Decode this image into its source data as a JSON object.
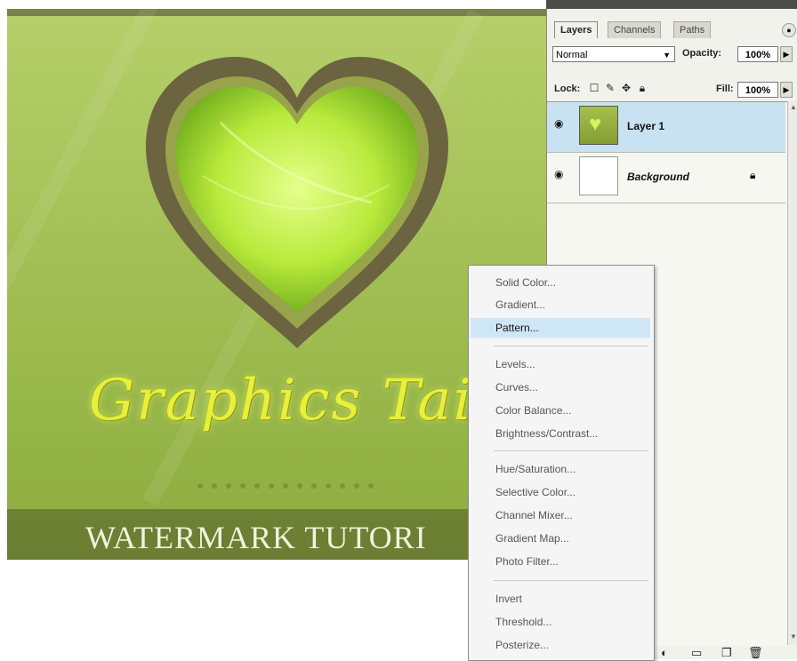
{
  "canvas": {
    "artwork_title": "Graphics Tailo",
    "banner_text": "WATERMARK TUTORI",
    "heart_color": "#c7f05a",
    "frame_color": "#6c6340"
  },
  "layers_panel": {
    "tabs": [
      "Layers",
      "Channels",
      "Paths"
    ],
    "blend_mode": "Normal",
    "opacity_label": "Opacity:",
    "opacity_value": "100%",
    "lock_label": "Lock:",
    "fill_label": "Fill:",
    "fill_value": "100%",
    "layers": [
      {
        "name": "Layer 1"
      },
      {
        "name": "Background"
      }
    ]
  },
  "adjustment_menu": {
    "items": [
      "Solid Color...",
      "Gradient...",
      "Pattern...",
      "Levels...",
      "Curves...",
      "Color Balance...",
      "Brightness/Contrast...",
      "Hue/Saturation...",
      "Selective Color...",
      "Channel Mixer...",
      "Gradient Map...",
      "Photo Filter...",
      "Invert",
      "Threshold...",
      "Posterize..."
    ],
    "highlighted": "Pattern..."
  }
}
